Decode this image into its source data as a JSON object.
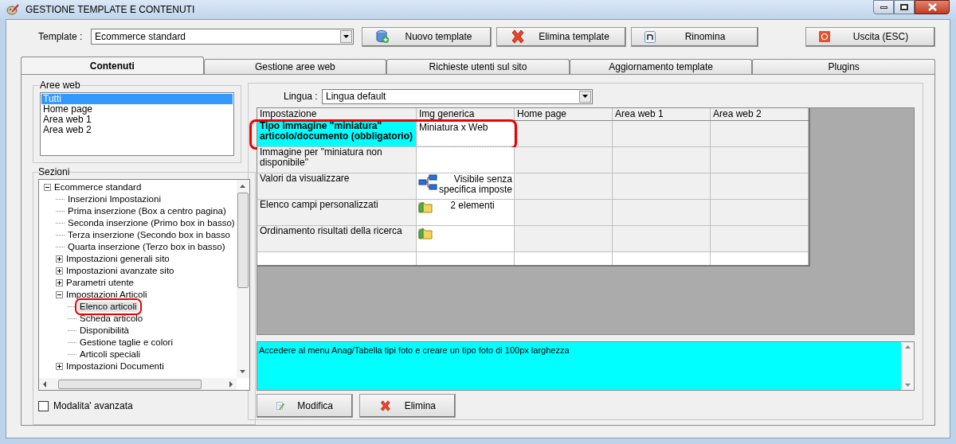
{
  "window": {
    "title": "GESTIONE TEMPLATE E CONTENUTI"
  },
  "template": {
    "label": "Template :",
    "value": "Ecommerce standard"
  },
  "toolbar": [
    {
      "label": "Nuovo template",
      "kind": "db"
    },
    {
      "label": "Elimina template",
      "kind": "x"
    },
    {
      "label": "Rinomina",
      "kind": "n"
    },
    {
      "label": "Uscita (ESC)",
      "kind": "exit"
    }
  ],
  "tabs": [
    {
      "label": "Contenuti",
      "selected": true
    },
    {
      "label": "Gestione aree web",
      "selected": false
    },
    {
      "label": "Richieste utenti sul sito",
      "selected": false
    },
    {
      "label": "Aggiornamento template",
      "selected": false
    },
    {
      "label": "Plugins",
      "selected": false
    }
  ],
  "aree_web": {
    "title": "Aree web",
    "items": [
      {
        "label": "Tutti",
        "selected": true
      },
      {
        "label": "Home page",
        "selected": false
      },
      {
        "label": "Area web 1",
        "selected": false
      },
      {
        "label": "Area web 2",
        "selected": false
      }
    ]
  },
  "sezioni": {
    "title": "Sezioni",
    "tree": [
      {
        "label": "Ecommerce standard",
        "kind": "folder",
        "expanded": true,
        "selected": false,
        "annotated": false,
        "children": [
          {
            "label": "Inserzioni Impostazioni",
            "kind": "leaf",
            "selected": false,
            "annotated": false
          },
          {
            "label": "Prima inserzione (Box a centro pagina)",
            "kind": "leaf",
            "selected": false,
            "annotated": false
          },
          {
            "label": "Seconda inserzione (Primo box in basso)",
            "kind": "leaf",
            "selected": false,
            "annotated": false
          },
          {
            "label": "Terza inserzione (Secondo box in basso",
            "kind": "leaf",
            "selected": false,
            "annotated": false
          },
          {
            "label": "Quarta inserzione (Terzo box in basso)",
            "kind": "leaf",
            "selected": false,
            "annotated": false
          },
          {
            "label": "Impostazioni generali sito",
            "kind": "folder",
            "expanded": false,
            "selected": false,
            "annotated": false
          },
          {
            "label": "Impostazioni avanzate sito",
            "kind": "folder",
            "expanded": false,
            "selected": false,
            "annotated": false
          },
          {
            "label": "Parametri utente",
            "kind": "folder",
            "expanded": false,
            "selected": false,
            "annotated": false
          },
          {
            "label": "Impostazioni Articoli",
            "kind": "folder",
            "expanded": true,
            "selected": false,
            "annotated": false,
            "children": [
              {
                "label": "Elenco articoli",
                "kind": "leaf",
                "selected": true,
                "annotated": true
              },
              {
                "label": "Scheda articolo",
                "kind": "leaf",
                "selected": false,
                "annotated": false
              },
              {
                "label": "Disponibilità",
                "kind": "leaf",
                "selected": false,
                "annotated": false
              },
              {
                "label": "Gestione taglie e colori",
                "kind": "leaf",
                "selected": false,
                "annotated": false
              },
              {
                "label": "Articoli speciali",
                "kind": "leaf",
                "selected": false,
                "annotated": false
              }
            ]
          },
          {
            "label": "Impostazioni Documenti",
            "kind": "folder",
            "expanded": false,
            "selected": false,
            "annotated": false
          }
        ]
      }
    ]
  },
  "advanced": {
    "label": "Modalita' avanzata",
    "checked": false
  },
  "lingua": {
    "label": "Lingua :",
    "value": "Lingua default"
  },
  "grid": {
    "columns": [
      "Impostazione",
      "Img generica",
      "Home page",
      "Area web 1",
      "Area web 2"
    ],
    "rows": [
      {
        "setting": "Tipo immagine \"miniatura\" articolo/documento (obbligatorio)",
        "value": "Miniatura x Web",
        "kind": "text",
        "selected": true,
        "annotated": true
      },
      {
        "setting": "Immagine per \"miniatura non disponibile\"",
        "kind": "text",
        "selected": false,
        "annotated": false
      },
      {
        "setting": "Valori da visualizzare",
        "value": "Visibile senza specifica imposte",
        "kind": "tree",
        "selected": false,
        "annotated": false
      },
      {
        "setting": "Elenco campi personalizzati",
        "value": "2 elementi",
        "kind": "folder",
        "selected": false,
        "annotated": false
      },
      {
        "setting": "Ordinamento risultati della ricerca",
        "kind": "folder",
        "selected": false,
        "annotated": false
      }
    ]
  },
  "description": "Accedere al menu Anag/Tabella tipi foto e creare un tipo foto di 100px larghezza",
  "actions": [
    {
      "label": "Modifica",
      "kind": "edit"
    },
    {
      "label": "Elimina",
      "kind": "x"
    }
  ]
}
